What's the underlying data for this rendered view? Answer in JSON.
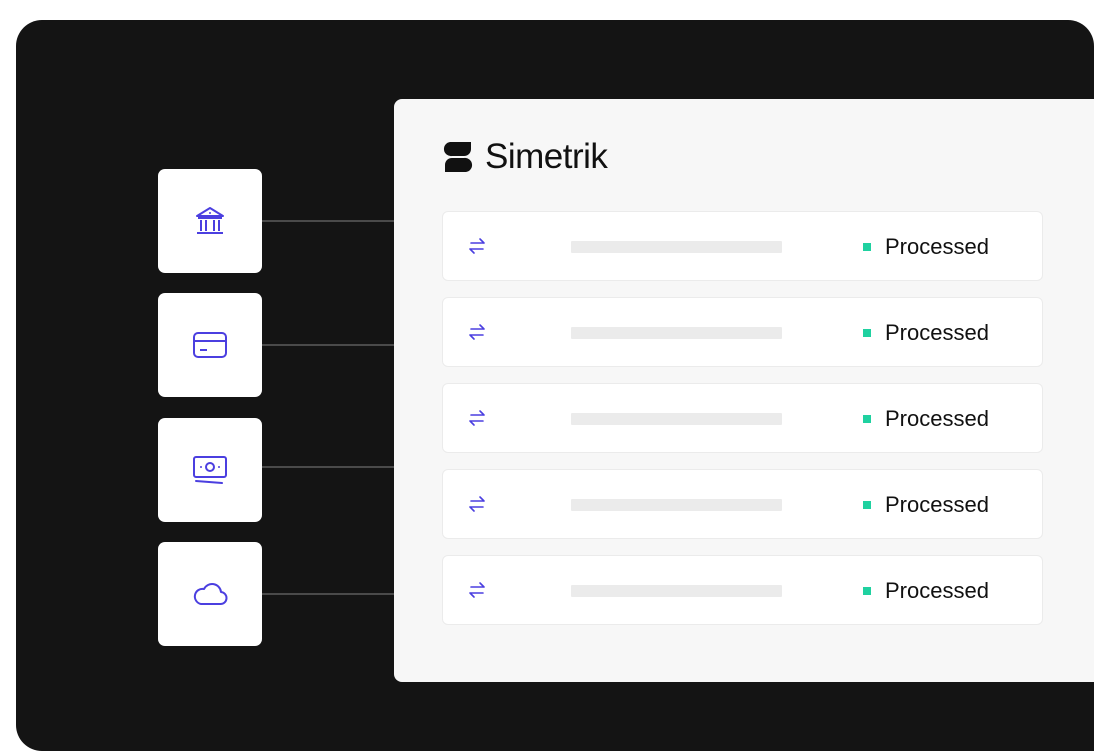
{
  "brand": {
    "name": "Simetrik",
    "logo_icon": "simetrik-logo-icon"
  },
  "sources": [
    {
      "id": "bank",
      "icon": "bank-icon"
    },
    {
      "id": "card",
      "icon": "credit-card-icon"
    },
    {
      "id": "cash",
      "icon": "banknote-icon"
    },
    {
      "id": "cloud",
      "icon": "cloud-icon"
    }
  ],
  "rows": [
    {
      "icon": "transfer-arrows-icon",
      "status": "Processed"
    },
    {
      "icon": "transfer-arrows-icon",
      "status": "Processed"
    },
    {
      "icon": "transfer-arrows-icon",
      "status": "Processed"
    },
    {
      "icon": "transfer-arrows-icon",
      "status": "Processed"
    },
    {
      "icon": "transfer-arrows-icon",
      "status": "Processed"
    }
  ],
  "colors": {
    "background": "#141414",
    "accent": "#4b3fe0",
    "status": "#1fd1a0",
    "panel": "#f7f7f7"
  }
}
